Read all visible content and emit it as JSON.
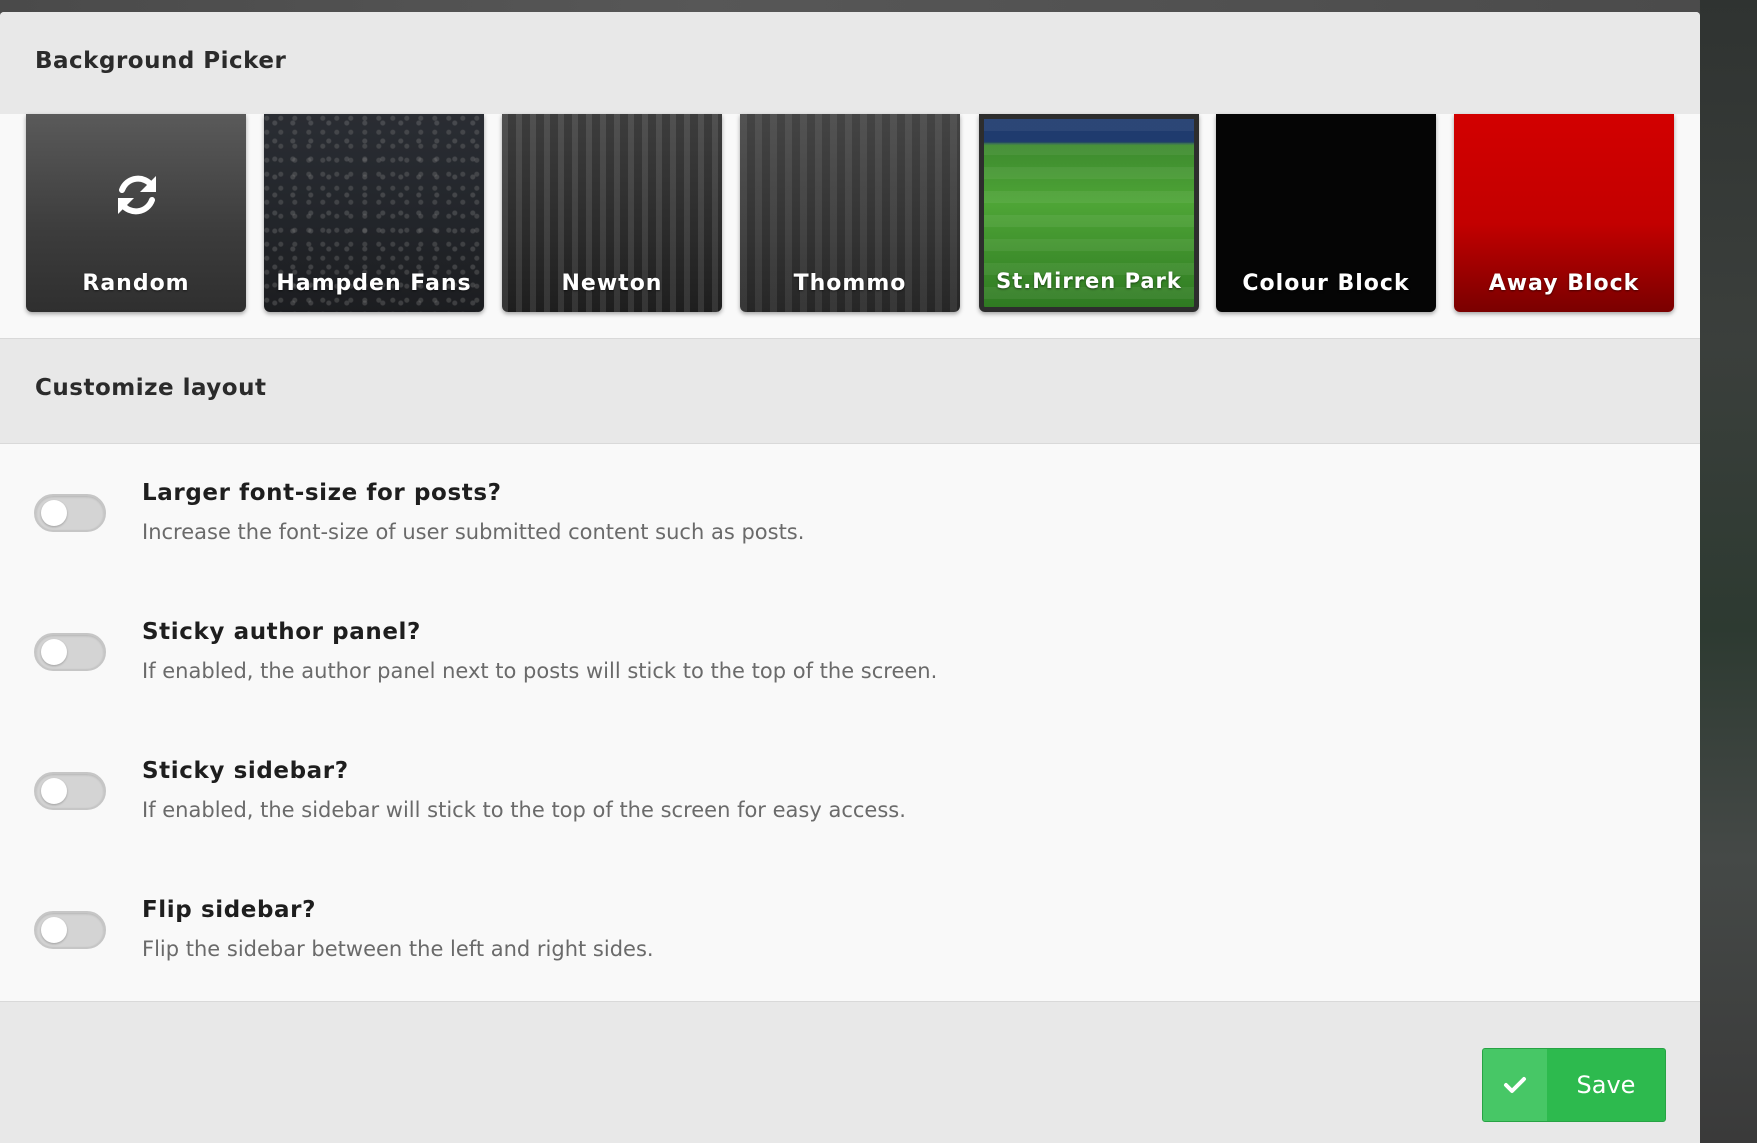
{
  "modal": {
    "background_section_title": "Background Picker",
    "layout_section_title": "Customize layout"
  },
  "backgrounds": [
    {
      "label": "Random",
      "icon": "refresh-icon"
    },
    {
      "label": "Hampden Fans"
    },
    {
      "label": "Newton"
    },
    {
      "label": "Thommo"
    },
    {
      "label": "St.Mirren Park",
      "selected": true
    },
    {
      "label": "Colour Block"
    },
    {
      "label": "Away Block"
    }
  ],
  "settings": [
    {
      "title": "Larger font-size for posts?",
      "description": "Increase the font-size of user submitted content such as posts.",
      "enabled": false
    },
    {
      "title": "Sticky author panel?",
      "description": "If enabled, the author panel next to posts will stick to the top of the screen.",
      "enabled": false
    },
    {
      "title": "Sticky sidebar?",
      "description": "If enabled, the sidebar will stick to the top of the screen for easy access.",
      "enabled": false
    },
    {
      "title": "Flip sidebar?",
      "description": "Flip the sidebar between the left and right sides.",
      "enabled": false
    }
  ],
  "footer": {
    "save_label": "Save",
    "save_icon": "check-icon"
  },
  "colors": {
    "save_green": "#2dba4e",
    "away_red": "#d20000"
  }
}
